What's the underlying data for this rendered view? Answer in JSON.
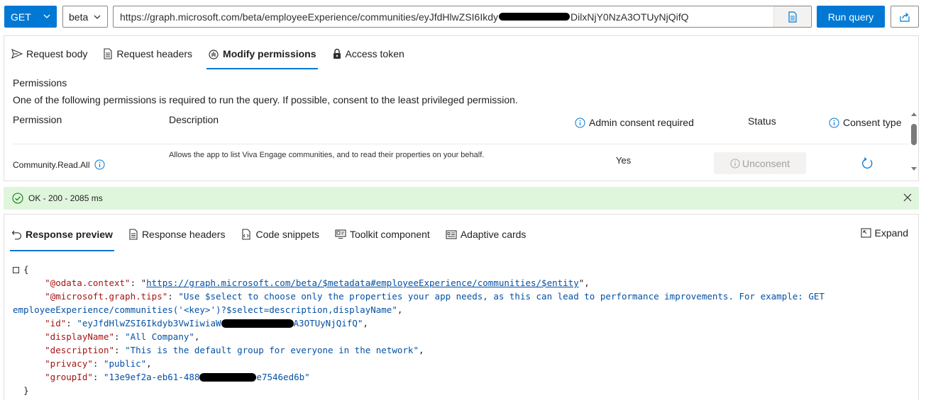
{
  "topbar": {
    "method": "GET",
    "version": "beta",
    "url_start": "https://graph.microsoft.com/beta/employeeExperience/communities/eyJfdHlwZSI6Ikdy",
    "url_end": "DilxNjY0NzA3OTUyNjQifQ",
    "run_label": "Run query",
    "accent": "#0078d4"
  },
  "request_tabs": [
    {
      "label": "Request body",
      "icon": "send-icon"
    },
    {
      "label": "Request headers",
      "icon": "document-icon"
    },
    {
      "label": "Modify permissions",
      "icon": "hand-icon",
      "active": true
    },
    {
      "label": "Access token",
      "icon": "lock-icon"
    }
  ],
  "permissions": {
    "title": "Permissions",
    "subtitle": "One of the following permissions is required to run the query. If possible, consent to the least privileged permission.",
    "headers": {
      "permission": "Permission",
      "description": "Description",
      "admin_consent": "Admin consent required",
      "status": "Status",
      "consent_type": "Consent type"
    },
    "rows": [
      {
        "permission": "Community.Read.All",
        "description": "Allows the app to list Viva Engage communities, and to read their properties on your behalf.",
        "admin_consent": "Yes",
        "status_button": "Unconsent"
      }
    ]
  },
  "status": {
    "text": "OK - 200 - 2085 ms",
    "color": "#dff6dd"
  },
  "response_tabs": [
    {
      "label": "Response preview",
      "icon": "undo-icon",
      "active": true
    },
    {
      "label": "Response headers",
      "icon": "document-icon"
    },
    {
      "label": "Code snippets",
      "icon": "code-icon"
    },
    {
      "label": "Toolkit component",
      "icon": "component-icon"
    },
    {
      "label": "Adaptive cards",
      "icon": "card-icon"
    }
  ],
  "expand_label": "Expand",
  "json": {
    "open_brace": "{",
    "close_brace": "}",
    "context_key": "\"@odata.context\"",
    "context_val": "https://graph.microsoft.com/beta/$metadata#employeeExperience/communities/$entity",
    "tips_key": "\"@microsoft.graph.tips\"",
    "tips_val_1": "\"Use $select to choose only the properties your app needs, as this can lead to performance improvements. For example: GET",
    "tips_val_2": "employeeExperience/communities('<key>')?$select=description,displayName\"",
    "id_key": "\"id\"",
    "id_start": "\"eyJfdHlwZSI6Ikdyb3VwIiwiaW",
    "id_end": "A3OTUyNjQifQ\"",
    "displayName_key": "\"displayName\"",
    "displayName_val": "\"All Company\"",
    "description_key": "\"description\"",
    "description_val": "\"This is the default group for everyone in the network\"",
    "privacy_key": "\"privacy\"",
    "privacy_val": "\"public\"",
    "groupId_key": "\"groupId\"",
    "groupId_start": "\"13e9ef2a-eb61-488",
    "groupId_end": "e7546ed6b\""
  }
}
